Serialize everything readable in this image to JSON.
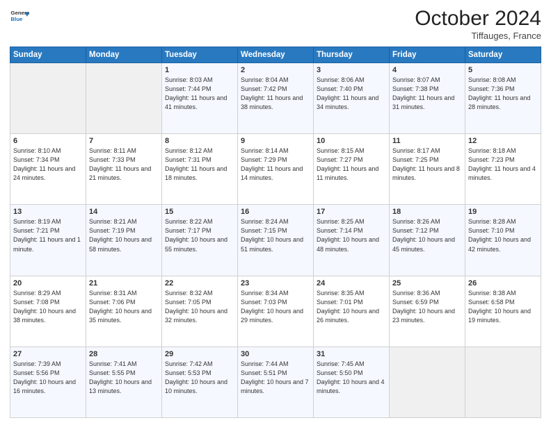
{
  "header": {
    "logo_line1": "General",
    "logo_line2": "Blue",
    "month": "October 2024",
    "location": "Tiffauges, France"
  },
  "weekdays": [
    "Sunday",
    "Monday",
    "Tuesday",
    "Wednesday",
    "Thursday",
    "Friday",
    "Saturday"
  ],
  "weeks": [
    [
      {
        "day": "",
        "info": ""
      },
      {
        "day": "",
        "info": ""
      },
      {
        "day": "1",
        "info": "Sunrise: 8:03 AM\nSunset: 7:44 PM\nDaylight: 11 hours and 41 minutes."
      },
      {
        "day": "2",
        "info": "Sunrise: 8:04 AM\nSunset: 7:42 PM\nDaylight: 11 hours and 38 minutes."
      },
      {
        "day": "3",
        "info": "Sunrise: 8:06 AM\nSunset: 7:40 PM\nDaylight: 11 hours and 34 minutes."
      },
      {
        "day": "4",
        "info": "Sunrise: 8:07 AM\nSunset: 7:38 PM\nDaylight: 11 hours and 31 minutes."
      },
      {
        "day": "5",
        "info": "Sunrise: 8:08 AM\nSunset: 7:36 PM\nDaylight: 11 hours and 28 minutes."
      }
    ],
    [
      {
        "day": "6",
        "info": "Sunrise: 8:10 AM\nSunset: 7:34 PM\nDaylight: 11 hours and 24 minutes."
      },
      {
        "day": "7",
        "info": "Sunrise: 8:11 AM\nSunset: 7:33 PM\nDaylight: 11 hours and 21 minutes."
      },
      {
        "day": "8",
        "info": "Sunrise: 8:12 AM\nSunset: 7:31 PM\nDaylight: 11 hours and 18 minutes."
      },
      {
        "day": "9",
        "info": "Sunrise: 8:14 AM\nSunset: 7:29 PM\nDaylight: 11 hours and 14 minutes."
      },
      {
        "day": "10",
        "info": "Sunrise: 8:15 AM\nSunset: 7:27 PM\nDaylight: 11 hours and 11 minutes."
      },
      {
        "day": "11",
        "info": "Sunrise: 8:17 AM\nSunset: 7:25 PM\nDaylight: 11 hours and 8 minutes."
      },
      {
        "day": "12",
        "info": "Sunrise: 8:18 AM\nSunset: 7:23 PM\nDaylight: 11 hours and 4 minutes."
      }
    ],
    [
      {
        "day": "13",
        "info": "Sunrise: 8:19 AM\nSunset: 7:21 PM\nDaylight: 11 hours and 1 minute."
      },
      {
        "day": "14",
        "info": "Sunrise: 8:21 AM\nSunset: 7:19 PM\nDaylight: 10 hours and 58 minutes."
      },
      {
        "day": "15",
        "info": "Sunrise: 8:22 AM\nSunset: 7:17 PM\nDaylight: 10 hours and 55 minutes."
      },
      {
        "day": "16",
        "info": "Sunrise: 8:24 AM\nSunset: 7:15 PM\nDaylight: 10 hours and 51 minutes."
      },
      {
        "day": "17",
        "info": "Sunrise: 8:25 AM\nSunset: 7:14 PM\nDaylight: 10 hours and 48 minutes."
      },
      {
        "day": "18",
        "info": "Sunrise: 8:26 AM\nSunset: 7:12 PM\nDaylight: 10 hours and 45 minutes."
      },
      {
        "day": "19",
        "info": "Sunrise: 8:28 AM\nSunset: 7:10 PM\nDaylight: 10 hours and 42 minutes."
      }
    ],
    [
      {
        "day": "20",
        "info": "Sunrise: 8:29 AM\nSunset: 7:08 PM\nDaylight: 10 hours and 38 minutes."
      },
      {
        "day": "21",
        "info": "Sunrise: 8:31 AM\nSunset: 7:06 PM\nDaylight: 10 hours and 35 minutes."
      },
      {
        "day": "22",
        "info": "Sunrise: 8:32 AM\nSunset: 7:05 PM\nDaylight: 10 hours and 32 minutes."
      },
      {
        "day": "23",
        "info": "Sunrise: 8:34 AM\nSunset: 7:03 PM\nDaylight: 10 hours and 29 minutes."
      },
      {
        "day": "24",
        "info": "Sunrise: 8:35 AM\nSunset: 7:01 PM\nDaylight: 10 hours and 26 minutes."
      },
      {
        "day": "25",
        "info": "Sunrise: 8:36 AM\nSunset: 6:59 PM\nDaylight: 10 hours and 23 minutes."
      },
      {
        "day": "26",
        "info": "Sunrise: 8:38 AM\nSunset: 6:58 PM\nDaylight: 10 hours and 19 minutes."
      }
    ],
    [
      {
        "day": "27",
        "info": "Sunrise: 7:39 AM\nSunset: 5:56 PM\nDaylight: 10 hours and 16 minutes."
      },
      {
        "day": "28",
        "info": "Sunrise: 7:41 AM\nSunset: 5:55 PM\nDaylight: 10 hours and 13 minutes."
      },
      {
        "day": "29",
        "info": "Sunrise: 7:42 AM\nSunset: 5:53 PM\nDaylight: 10 hours and 10 minutes."
      },
      {
        "day": "30",
        "info": "Sunrise: 7:44 AM\nSunset: 5:51 PM\nDaylight: 10 hours and 7 minutes."
      },
      {
        "day": "31",
        "info": "Sunrise: 7:45 AM\nSunset: 5:50 PM\nDaylight: 10 hours and 4 minutes."
      },
      {
        "day": "",
        "info": ""
      },
      {
        "day": "",
        "info": ""
      }
    ]
  ]
}
